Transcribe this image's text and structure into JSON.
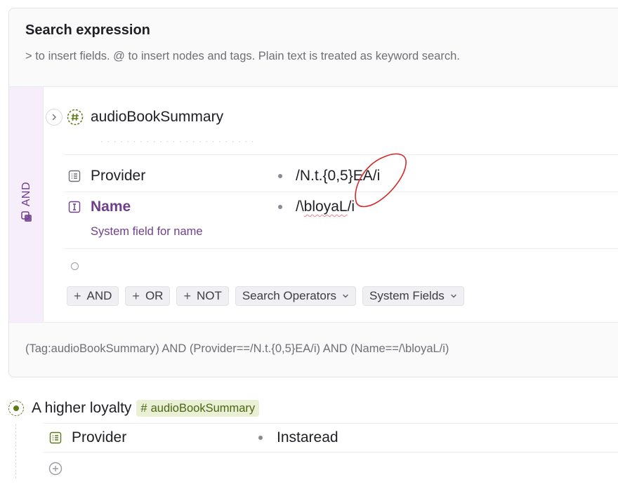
{
  "header": {
    "title": "Search expression",
    "hint": "> to insert fields. @ to insert nodes and tags. Plain text is treated as keyword search."
  },
  "expression": {
    "operator_label": "AND",
    "tag_name": "audioBookSummary",
    "fields": [
      {
        "name": "Provider",
        "value": "/N.t.{0,5}EA/i",
        "system": false
      },
      {
        "name": "Name",
        "value_prefix": "/\\",
        "value_misspelled": "bloyaL",
        "value_suffix": "/i",
        "system": true,
        "description": "System field for name"
      }
    ],
    "buttons": {
      "and": "AND",
      "or": "OR",
      "not": "NOT",
      "plus": "+",
      "search_operators": "Search Operators",
      "system_fields": "System Fields"
    }
  },
  "footer": {
    "query": "(Tag:audioBookSummary) AND (Provider==/N.t.{0,5}EA/i) AND (Name==/\\bloyaL/i)"
  },
  "result": {
    "title": "A higher loyalty",
    "tag_hash": "#",
    "tag": "audioBookSummary",
    "field_name": "Provider",
    "field_value": "Instaread"
  },
  "colors": {
    "accent_purple": "#6f3f8c",
    "tag_green": "#5e7a18",
    "annotation_red": "#d62828"
  },
  "icons": [
    "chevron-right-icon",
    "hash-tag-icon",
    "list-field-icon",
    "text-cursor-field-icon",
    "and-operator-icon",
    "chevron-down-icon",
    "add-circle-icon"
  ]
}
